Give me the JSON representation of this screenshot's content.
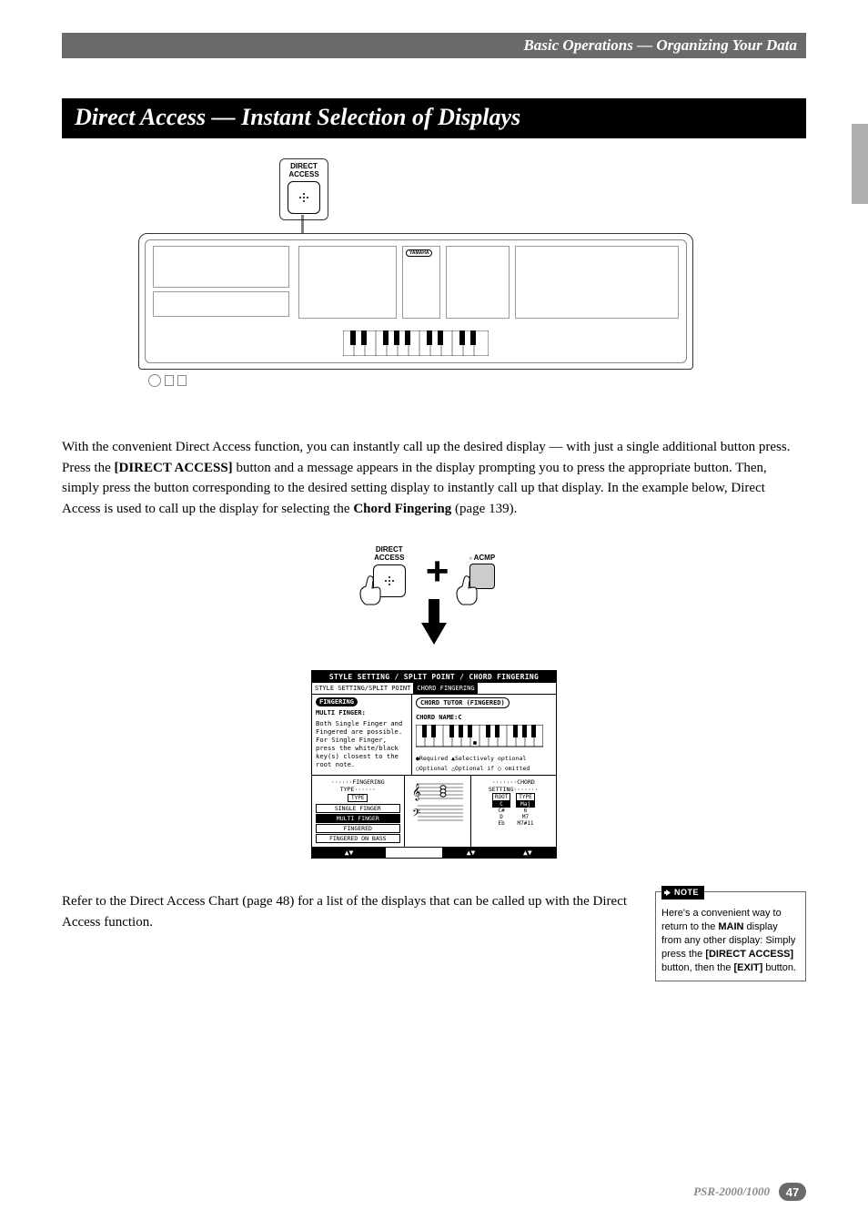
{
  "header": "Basic Operations — Organizing Your Data",
  "title": "Direct Access — Instant Selection of Displays",
  "direct_access_label_1": "DIRECT",
  "direct_access_label_2": "ACCESS",
  "brand_label": "YAMAHA",
  "paragraph1_a": "With the convenient Direct Access function, you can instantly call up the desired display — with just a single additional button press. Press the ",
  "paragraph1_btn": "[DIRECT ACCESS]",
  "paragraph1_b": " button and a message appears in the display prompting you to press the appropriate button. Then, simply press the button corresponding to the desired setting display to instantly call up that display. In the example below, Direct Access is used to call up the display for selecting the ",
  "paragraph1_bold": "Chord Fingering",
  "paragraph1_c": " (page 139).",
  "acmp_label": "ACMP",
  "lcd": {
    "title": "STYLE SETTING / SPLIT POINT / CHORD FINGERING",
    "tab1": "STYLE SETTING/SPLIT POINT",
    "tab2": "CHORD FINGERING",
    "fingering_badge": "FINGERING",
    "tutor_badge": "CHORD TUTOR (FINGERED)",
    "multi_finger_label": "MULTI FINGER:",
    "multi_finger_desc": "Both Single Finger and Fingered are possible. For Single Finger, press the white/black key(s) closest to the root note.",
    "chord_name_label": "CHORD NAME:",
    "chord_name_value": "C",
    "legend1": "●Required  ▲Selectively optional",
    "legend2": "○Optional  △Optional if ○ omitted",
    "fingering_type_header": "FINGERING TYPE",
    "type_col": "TYPE",
    "types": [
      "SINGLE FINGER",
      "MULTI FINGER",
      "FINGERED",
      "FINGERED ON BASS"
    ],
    "type_selected_index": 1,
    "chord_setting_header": "CHORD SETTING",
    "root_col": "ROOT",
    "root_values": [
      "C",
      "C#",
      "D",
      "Eb"
    ],
    "type2_col": "TYPE",
    "type2_values": [
      "Maj",
      "6",
      "M7",
      "M7#11"
    ],
    "footer_arrows": "▲▼"
  },
  "closing_a": "Refer to the Direct Access Chart (page 48) for a list of the displays that can be called up with the Direct Access function.",
  "note_label": "NOTE",
  "note_a": "Here's a convenient way to return to the ",
  "note_main": "MAIN",
  "note_b": " display from any other display: Simply press the ",
  "note_btn1": "[DIRECT ACCESS]",
  "note_c": " button, then the ",
  "note_btn2": "[EXIT]",
  "note_d": " button.",
  "footer_model": "PSR-2000/1000",
  "footer_page": "47"
}
